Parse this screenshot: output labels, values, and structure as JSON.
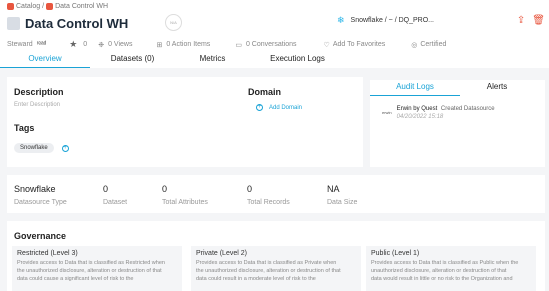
{
  "breadcrumb": {
    "root": "Catalog",
    "current": "Data Control WH"
  },
  "title": "Data Control WH",
  "circle_label": "N/A",
  "datasource": {
    "path": "Snowflake / ~ / DQ_PRO..."
  },
  "meta": {
    "steward_label": "Steward",
    "steward_value": "ʳᵉᵃᵈ",
    "rating": "0",
    "views": "0 Views",
    "action_items": "0 Action Items",
    "conversations": "0 Conversations",
    "favorites": "Add To Favorites",
    "certified": "Certified"
  },
  "tabs": [
    "Overview",
    "Datasets (0)",
    "Metrics",
    "Execution Logs"
  ],
  "description": {
    "heading": "Description",
    "placeholder": "Enter Description"
  },
  "domain": {
    "heading": "Domain",
    "add_label": "Add Domain"
  },
  "tags": {
    "heading": "Tags",
    "items": [
      "Snowflake"
    ]
  },
  "audit": {
    "tabs": [
      "Audit Logs",
      "Alerts"
    ],
    "entry": {
      "logo": "erwin",
      "user": "Erwin by Quest",
      "action": "Created Datasource",
      "time": "04/20/2022 15:18"
    }
  },
  "stats": [
    {
      "value": "Snowflake",
      "label": "Datasource Type"
    },
    {
      "value": "0",
      "label": "Dataset"
    },
    {
      "value": "0",
      "label": "Total Attributes"
    },
    {
      "value": "0",
      "label": "Total Records"
    },
    {
      "value": "NA",
      "label": "Data Size"
    }
  ],
  "governance": {
    "heading": "Governance",
    "cards": [
      {
        "title": "Restricted (Level 3)",
        "lines": [
          "Provides access to Data that is classified as Restricted when",
          "the unauthorized disclosure, alteration or destruction of that",
          "data could cause a significant level of risk to the"
        ]
      },
      {
        "title": "Private (Level 2)",
        "lines": [
          "Provides access to Data that is classified as Private when",
          "the unauthorized disclosure, alteration or destruction of that",
          "data could result in a moderate level of risk to the"
        ]
      },
      {
        "title": "Public (Level 1)",
        "lines": [
          "Provides access to Data that is classified as Public when the",
          "unauthorized disclosure, alteration or destruction of that",
          "data would result in little or no risk to the Organization and"
        ]
      }
    ]
  },
  "colors": {
    "accent": "#1aa3d6",
    "brand": "#e8563f"
  }
}
